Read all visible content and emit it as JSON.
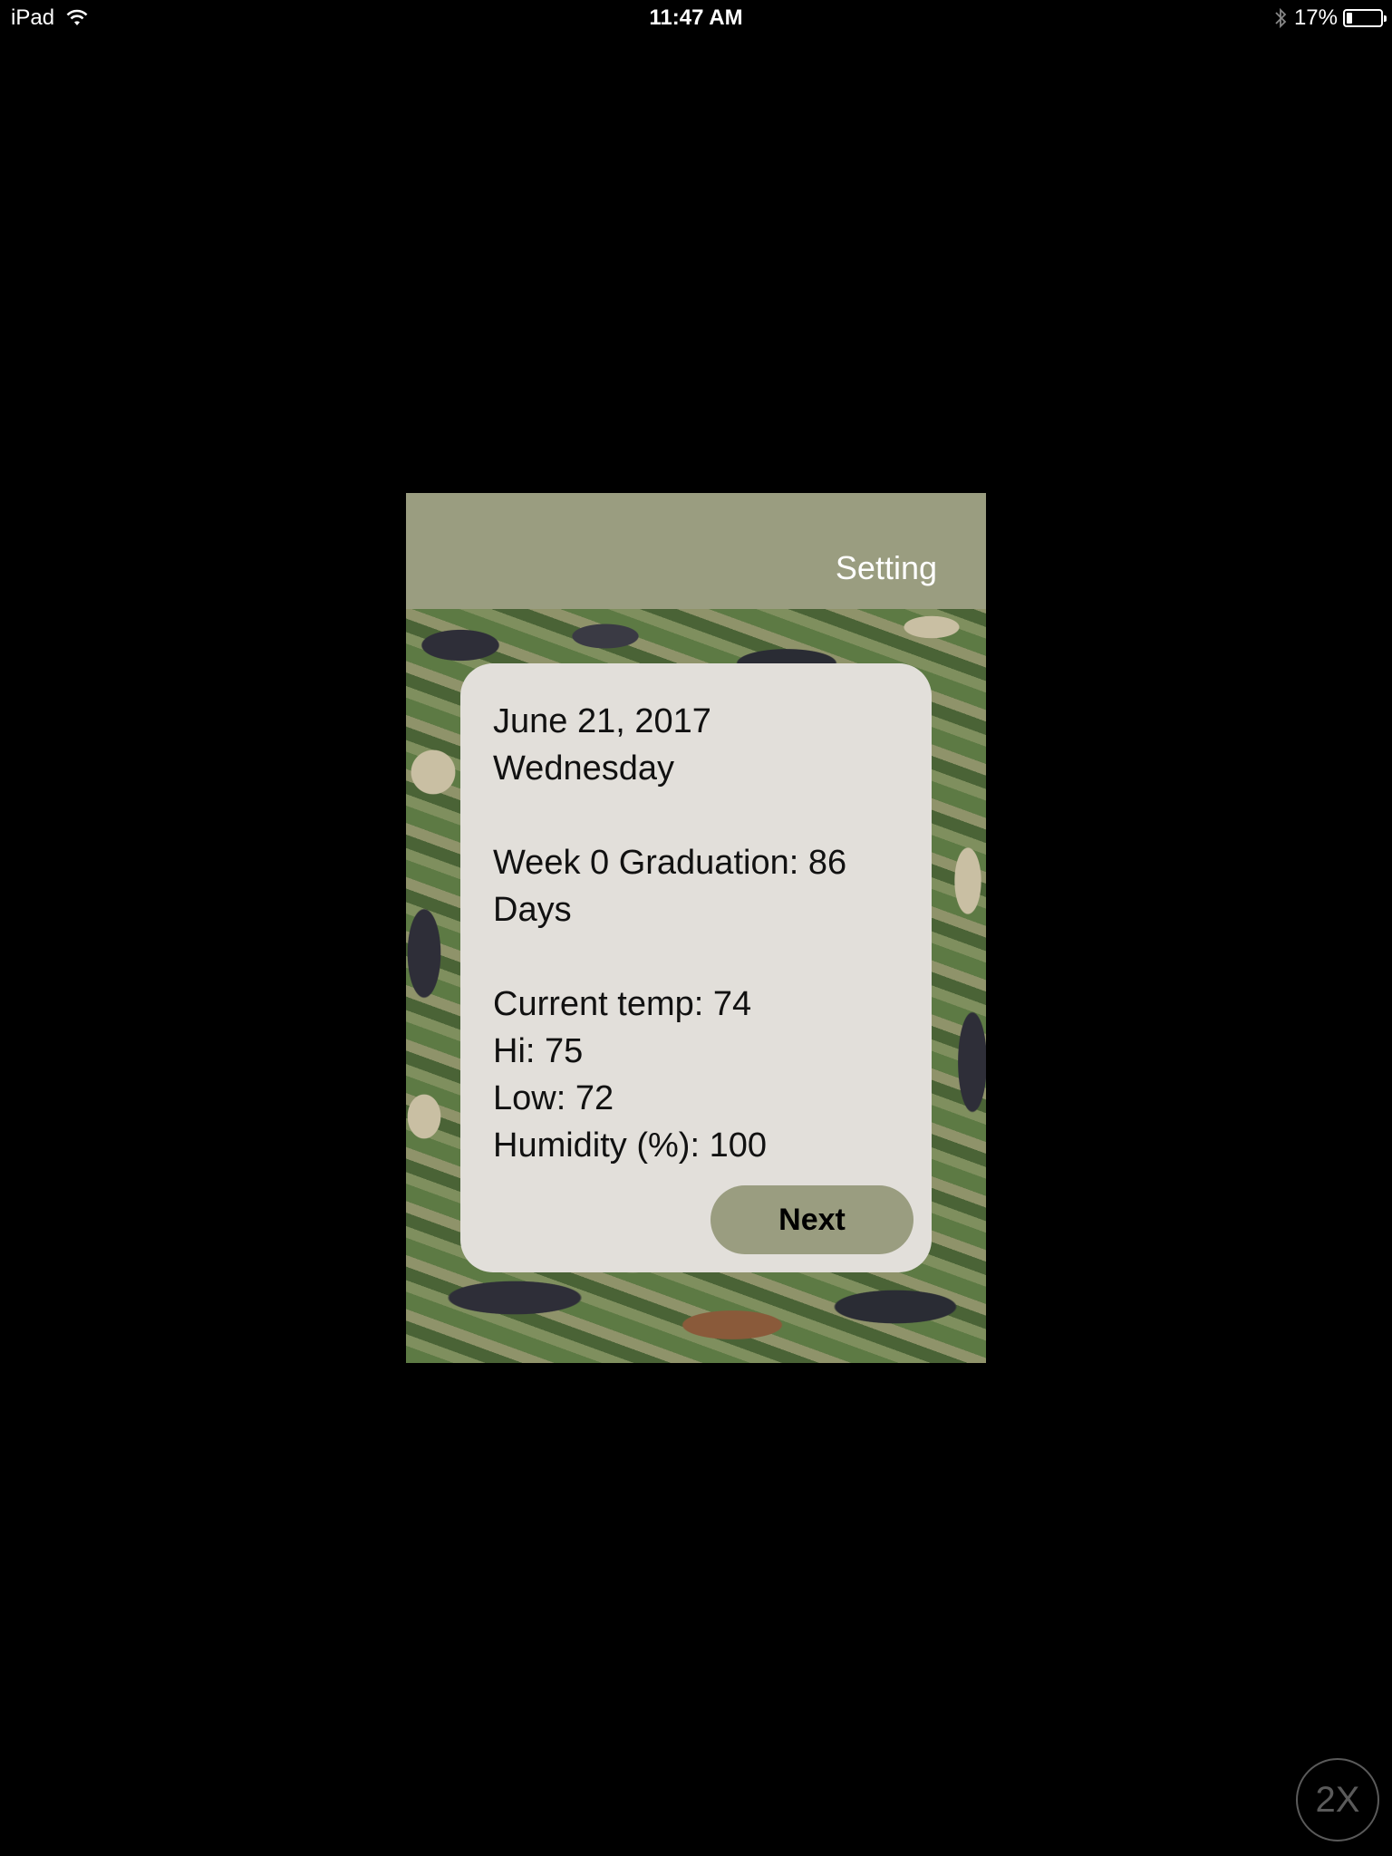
{
  "status_bar": {
    "device": "iPad",
    "time": "11:47 AM",
    "battery_percent_label": "17%",
    "battery_level": 0.17,
    "icons": [
      "wifi-icon",
      "bluetooth-icon",
      "battery-icon"
    ]
  },
  "nav": {
    "setting_label": "Setting"
  },
  "card": {
    "date": "June 21, 2017",
    "weekday": "Wednesday",
    "graduation_line1": "Week 0 Graduation: 86",
    "graduation_line2": "Days",
    "current_temp": "Current temp: 74",
    "hi": "Hi: 75",
    "low": "Low: 72",
    "humidity": "Humidity (%): 100",
    "next_label": "Next"
  },
  "zoom": {
    "label": "2X"
  },
  "colors": {
    "nav_bar": "#9a9d80",
    "card_bg": "#e2dfda",
    "button_bg": "#9a9d80",
    "screen_bg": "#000000"
  }
}
